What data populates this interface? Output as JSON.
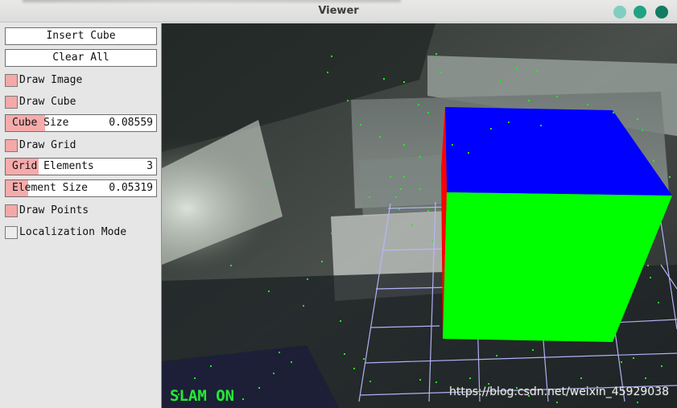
{
  "window": {
    "title": "Viewer",
    "colors": {
      "minimize": "#7fcfbf",
      "maximize": "#1fa383",
      "close": "#137a63"
    }
  },
  "panel": {
    "insert_cube": "Insert Cube",
    "clear_all": "Clear All",
    "draw_image": {
      "label": "Draw Image",
      "checked": true
    },
    "draw_cube": {
      "label": "Draw Cube",
      "checked": true
    },
    "cube_size": {
      "label": "Cube Size",
      "value": "0.08559",
      "fraction": 0.26
    },
    "draw_grid": {
      "label": "Draw Grid",
      "checked": true
    },
    "grid_elements": {
      "label": "Grid Elements",
      "value": "3",
      "fraction": 0.22
    },
    "element_size": {
      "label": "Element Size",
      "value": "0.05319",
      "fraction": 0.15
    },
    "draw_points": {
      "label": "Draw Points",
      "checked": true
    },
    "localization_mode": {
      "label": "Localization Mode",
      "checked": false
    }
  },
  "viewport": {
    "status": "SLAM ON",
    "watermark": "https://blog.csdn.net/weixin_45929038",
    "colors": {
      "cube_top": "#0000ff",
      "cube_front": "#00ff00",
      "cube_side": "#ff0000",
      "grid": "#b8b8ff",
      "points": "#22ee22"
    }
  }
}
